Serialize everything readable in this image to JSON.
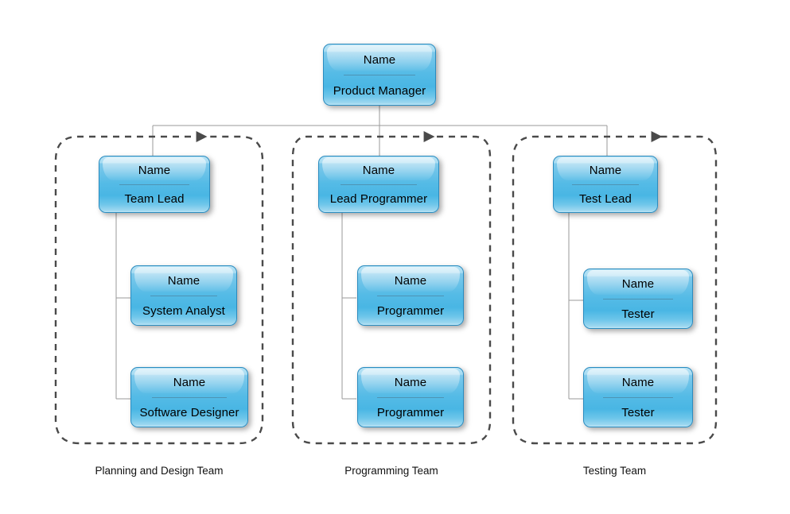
{
  "diagram": {
    "title_text": "",
    "type": "organizational-chart",
    "colors": {
      "node_border": "#2a8cc0",
      "node_fill_light": "#b5e2f5",
      "node_fill_mid": "#49b6e4",
      "connector_line": "#9a9a9a",
      "group_border_dashed": "#555555",
      "text": "#000000"
    },
    "name_label": "Name",
    "root": {
      "name": "Name",
      "role": "Product Manager"
    },
    "groups": [
      {
        "caption": "Planning and Design Team",
        "lead": {
          "name": "Name",
          "role": "Team Lead"
        },
        "members": [
          {
            "name": "Name",
            "role": "System Analyst"
          },
          {
            "name": "Name",
            "role": "Software Designer"
          }
        ]
      },
      {
        "caption": "Programming Team",
        "lead": {
          "name": "Name",
          "role": "Lead Programmer"
        },
        "members": [
          {
            "name": "Name",
            "role": "Programmer"
          },
          {
            "name": "Name",
            "role": "Programmer"
          }
        ]
      },
      {
        "caption": "Testing Team",
        "lead": {
          "name": "Name",
          "role": "Test Lead"
        },
        "members": [
          {
            "name": "Name",
            "role": "Tester"
          },
          {
            "name": "Name",
            "role": "Tester"
          }
        ]
      }
    ]
  }
}
